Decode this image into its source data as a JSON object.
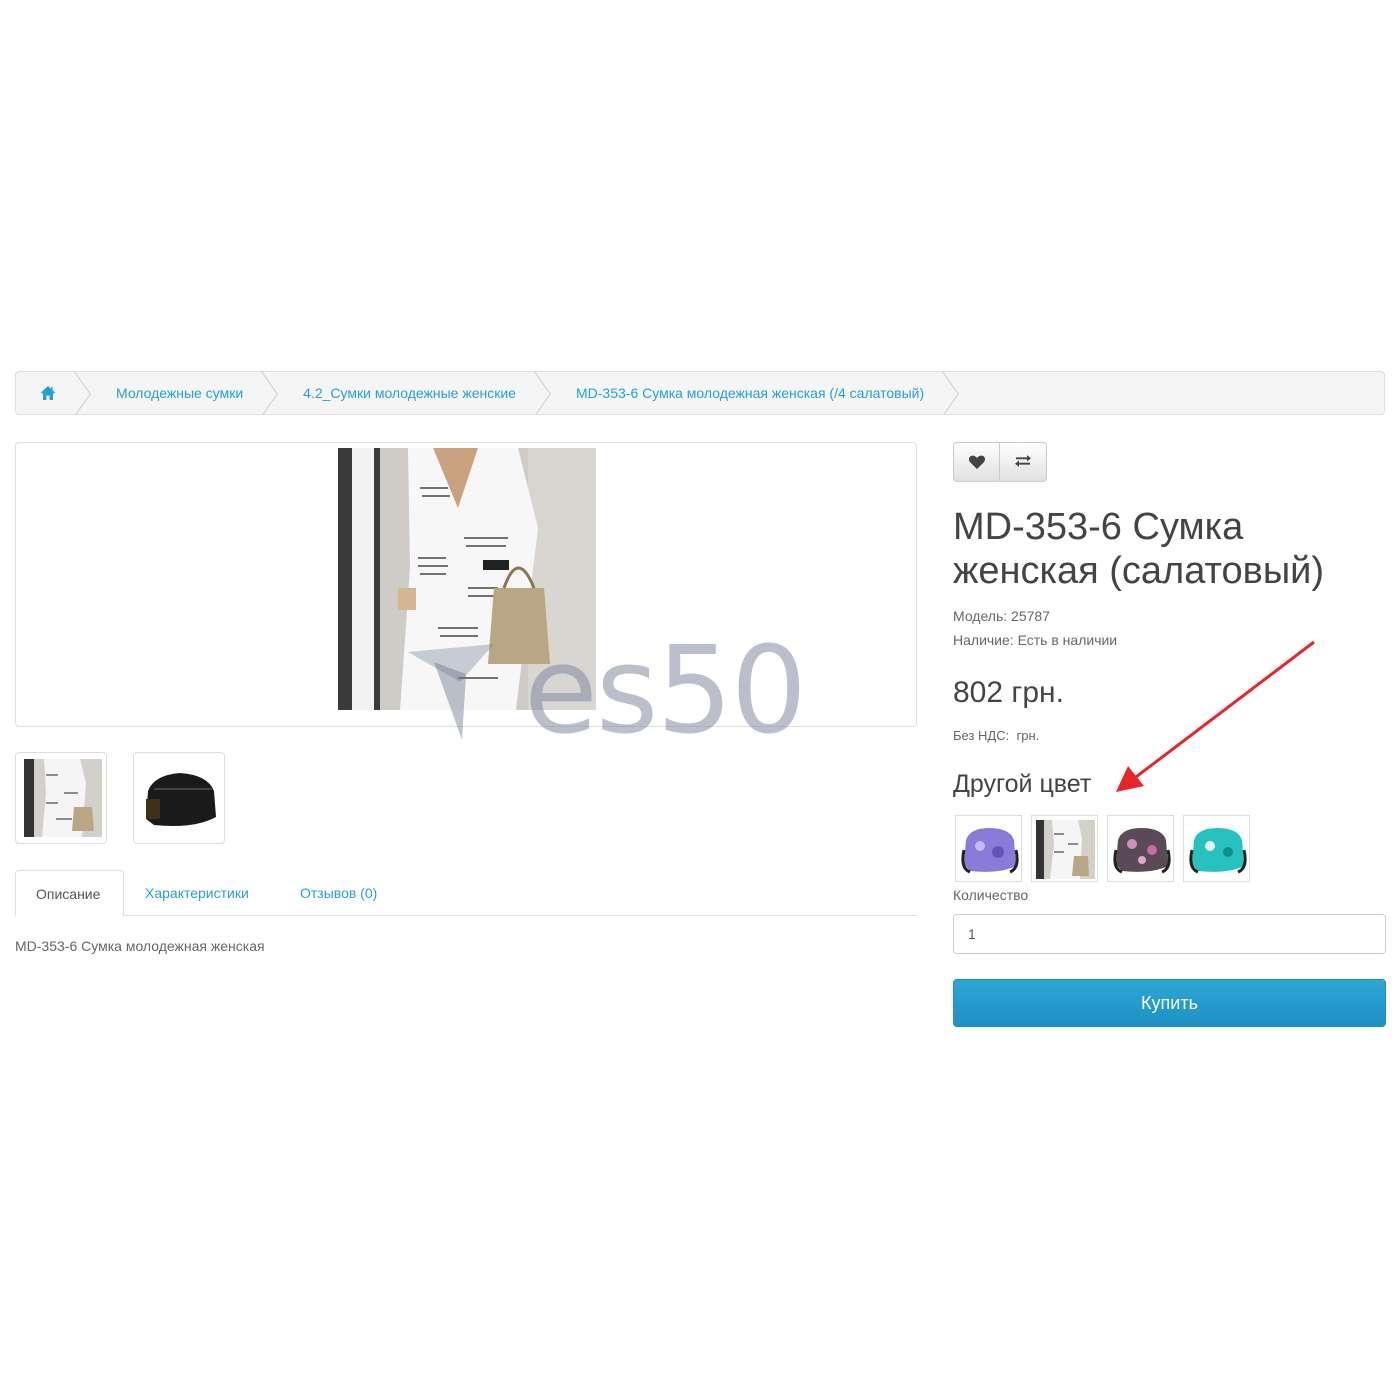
{
  "breadcrumb": {
    "home_icon": "home-icon",
    "items": [
      "Молодежные сумки",
      "4.2_Сумки молодежные женские",
      "MD-353-6 Сумка молодежная женская (/4 салатовый)"
    ]
  },
  "watermark": "es50",
  "tabs": [
    "Описание",
    "Характеристики",
    "Отзывов (0)"
  ],
  "description": "MD-353-6 Сумка молодежная женская",
  "product": {
    "title": "MD-353-6 Сумка женская (салатовый)",
    "model_label": "Модель:",
    "model_value": "25787",
    "availability_label": "Наличие:",
    "availability_value": "Есть в наличии",
    "price": "802 грн.",
    "tax_label": "Без НДС:",
    "tax_value": "грн.",
    "other_color": "Другой цвет",
    "qty_label": "Количество",
    "qty_value": "1",
    "buy_label": "Купить"
  },
  "icons": {
    "wishlist": "heart-icon",
    "compare": "exchange-icon"
  },
  "colors": {
    "link": "#23a1d1",
    "button": "#229ac8",
    "arrow": "#e8242b"
  }
}
